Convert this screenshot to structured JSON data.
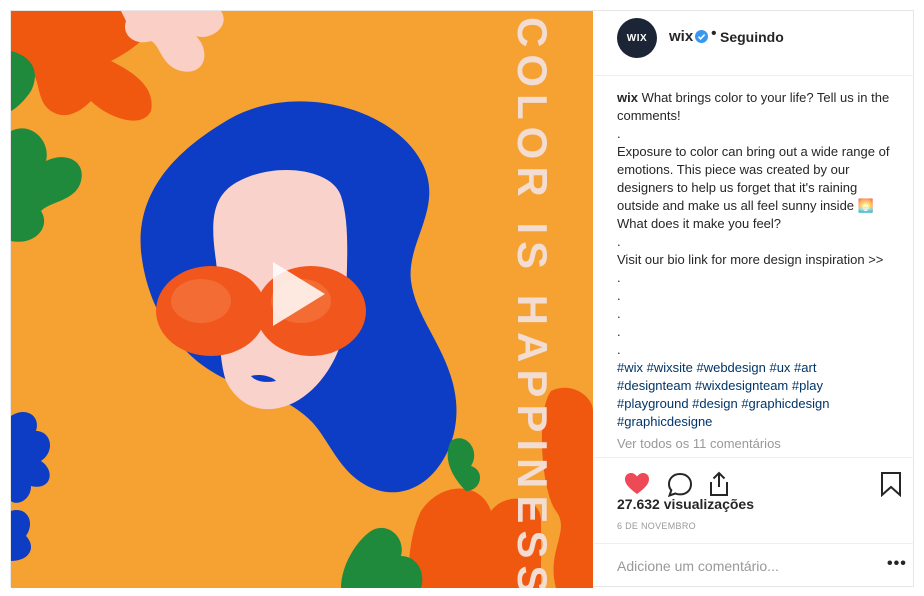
{
  "media": {
    "overlay_text": "COLOR IS HAPPINESS",
    "play_icon": "play-icon",
    "colors": {
      "background": "#f5a233",
      "hair": "#0c3dc4",
      "skin": "#f9d2cc",
      "glasses": "#f1571c",
      "leaf_green": "#1f8a3c",
      "leaf_orange": "#f0570f",
      "leaf_pink": "#f9cfc6",
      "vertical_text": "#f3dcd1"
    }
  },
  "header": {
    "avatar_text": "WIX",
    "username": "wix",
    "verified_icon": "verified-badge-icon",
    "separator": "•",
    "follow_status": "Seguindo"
  },
  "caption": {
    "username": "wix",
    "lines": [
      "What brings color to your life? Tell us in the",
      "comments!",
      ".",
      "Exposure to color can bring out a wide range of",
      "emotions. This piece was created by our",
      "designers to help us forget that it's raining",
      "outside and make us all feel sunny inside 🌅",
      "What does it make you feel?",
      ".",
      "Visit our bio link for more design inspiration >>",
      ".",
      ".",
      ".",
      ".",
      "."
    ],
    "hashtag_lines": [
      "#wix #wixsite #webdesign #ux #art",
      "#designteam #wixdesignteam #play",
      "#playground #design #graphicdesign",
      "#graphicdesigne"
    ]
  },
  "comments_link": "Ver todos os 11 comentários",
  "actions": {
    "icons": [
      "heart-icon",
      "comment-icon",
      "share-icon",
      "bookmark-icon"
    ],
    "liked_color": "#ed4956"
  },
  "views": "27.632 visualizações",
  "date": "6 DE NOVEMBRO",
  "comment_input": {
    "placeholder": "Adicione um comentário..."
  },
  "more_options": "•••"
}
